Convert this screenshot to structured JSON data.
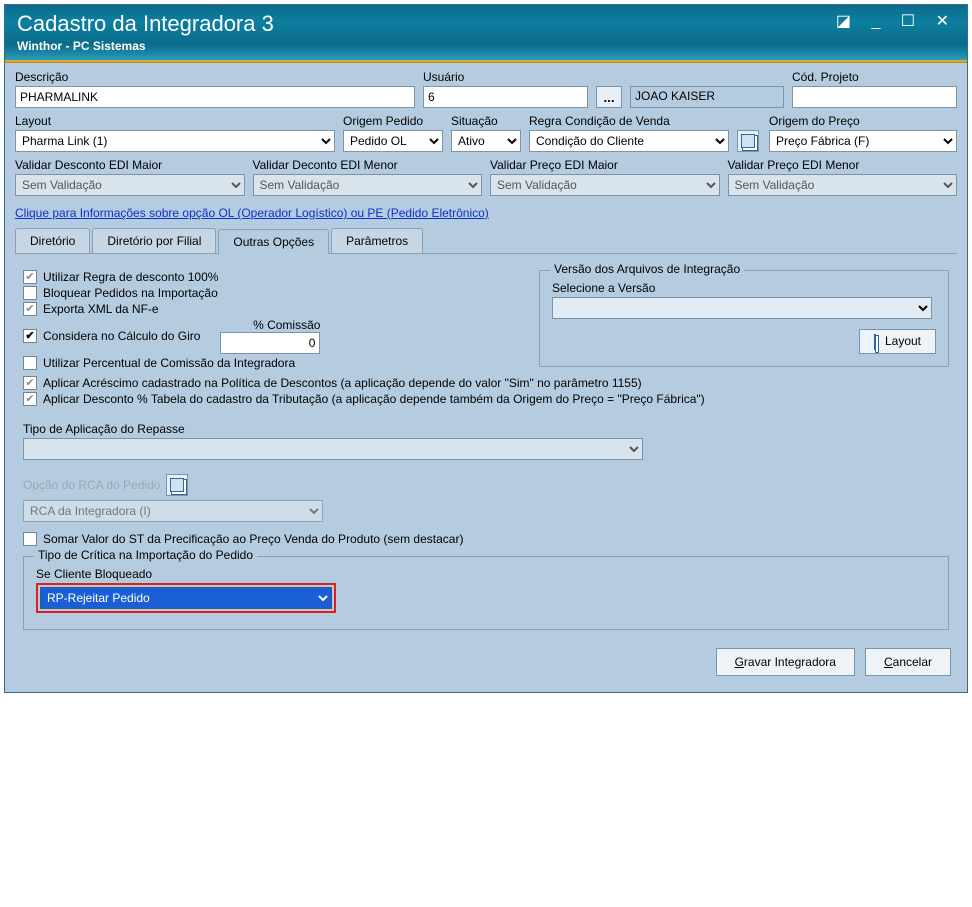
{
  "titlebar": {
    "title": "Cadastro da Integradora 3",
    "subtitle": "Winthor - PC Sistemas"
  },
  "fields": {
    "descricao_label": "Descrição",
    "descricao_value": "PHARMALINK",
    "usuario_label": "Usuário",
    "usuario_code": "6",
    "usuario_name": "JOAO KAISER",
    "cod_projeto_label": "Cód. Projeto",
    "cod_projeto_value": "",
    "layout_label": "Layout",
    "layout_value": "Pharma Link (1)",
    "origem_pedido_label": "Origem Pedido",
    "origem_pedido_value": "Pedido OL",
    "situacao_label": "Situação",
    "situacao_value": "Ativo",
    "regra_label": "Regra Condição de Venda",
    "regra_value": "Condição do Cliente",
    "origem_preco_label": "Origem do Preço",
    "origem_preco_value": "Preço Fábrica (F)",
    "val_desc_maior_label": "Validar Desconto EDI Maior",
    "val_desc_menor_label": "Validar Deconto EDI Menor",
    "val_preco_maior_label": "Validar Preço EDI Maior",
    "val_preco_menor_label": "Validar Preço EDI Menor",
    "sem_validacao": "Sem Validação"
  },
  "link_info": "Clique para Informações sobre opção OL (Operador Logístico) ou PE (Pedido Eletrônico)",
  "tabs": {
    "t1": "Diretório",
    "t2": "Diretório por Filial",
    "t3": "Outras Opções",
    "t4": "Parâmetros"
  },
  "options": {
    "chk1": "Utilizar Regra de desconto 100%",
    "chk2": "Bloquear Pedidos na Importação",
    "chk3": "Exporta XML da NF-e",
    "chk4": "Considera no Cálculo do Giro",
    "chk5": "Utilizar Percentual de Comissão da Integradora",
    "chk6": "Aplicar Acréscimo cadastrado na Política de Descontos (a aplicação depende do valor \"Sim\" no parâmetro 1155)",
    "chk7": "Aplicar Desconto % Tabela do cadastro da Tributação (a aplicação depende também da Origem do Preço = \"Preço Fábrica\")",
    "comissao_label": "% Comissão",
    "comissao_value": "0"
  },
  "versao_group": {
    "title": "Versão dos Arquivos de Integração",
    "sel_label": "Selecione a Versão",
    "layout_btn": "Layout"
  },
  "repasse_label": "Tipo de Aplicação do Repasse",
  "rca": {
    "label": "Opção do RCA do Pedido",
    "value": "RCA da Integradora (I)"
  },
  "chk_st": "Somar Valor do ST da Precificação ao Preço Venda do Produto (sem destacar)",
  "critica": {
    "title": "Tipo de Crítica na Importação do Pedido",
    "sub": "Se Cliente Bloqueado",
    "value": "RP-Rejeitar Pedido"
  },
  "footer": {
    "save": "Gravar Integradora",
    "cancel": "Cancelar"
  }
}
